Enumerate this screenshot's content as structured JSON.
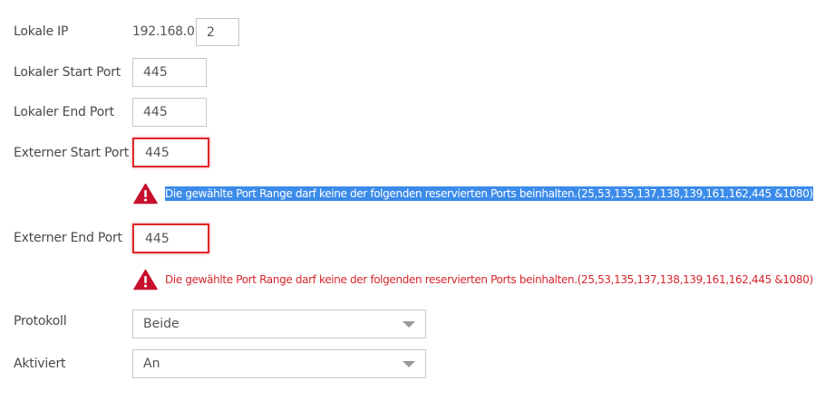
{
  "fields": {
    "local_ip": {
      "label": "Lokale IP",
      "prefix": "192.168.0.",
      "value": "2"
    },
    "local_start_port": {
      "label": "Lokaler Start Port",
      "value": "445"
    },
    "local_end_port": {
      "label": "Lokaler End Port",
      "value": "445"
    },
    "external_start_port": {
      "label": "Externer Start Port",
      "value": "445",
      "error": "Die gewählte Port Range darf keine der folgenden reservierten Ports beinhalten.(25,53,135,137,138,139,161,162,445 &1080)"
    },
    "external_end_port": {
      "label": "Externer End Port",
      "value": "445",
      "error": "Die gewählte Port Range darf keine der folgenden reservierten Ports beinhalten.(25,53,135,137,138,139,161,162,445 &1080)"
    },
    "protocol": {
      "label": "Protokoll",
      "value": "Beide"
    },
    "activated": {
      "label": "Aktiviert",
      "value": "An"
    }
  },
  "icons": {
    "warning": "warning-triangle-icon",
    "dropdown": "chevron-down-icon"
  },
  "colors": {
    "error": "#d7262c",
    "error_border": "#e0262a",
    "selection": "#3b8bea",
    "warning_icon": "#c8102e"
  }
}
